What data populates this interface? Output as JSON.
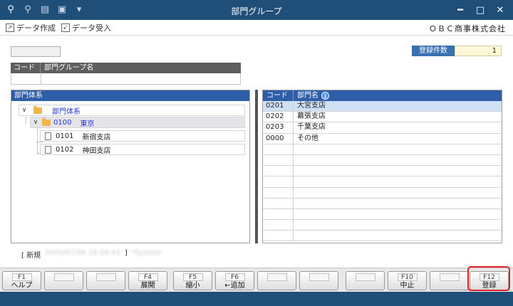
{
  "window": {
    "title": "部門グループ",
    "toolbar_icons": [
      "search-plus-icon",
      "search-icon",
      "printer-icon",
      "export-icon",
      "dropdown-icon"
    ],
    "controls": {
      "minimize": "━",
      "maximize": "□",
      "close": "✕"
    }
  },
  "toolbar": {
    "create_data": "データ作成",
    "receive_data": "データ受入",
    "company": "ＯＢＣ商事株式会社"
  },
  "record_count": {
    "label": "登録件数",
    "value": "1"
  },
  "group_table": {
    "headers": [
      "コード",
      "部門グループ名"
    ]
  },
  "tree": {
    "header": "部門体系",
    "root": "部門体系",
    "branch": {
      "code": "0100",
      "name": "東京"
    },
    "leaves": [
      {
        "code": "0101",
        "name": "新宿支店"
      },
      {
        "code": "0102",
        "name": "神田支店"
      }
    ]
  },
  "dept_list": {
    "headers": [
      "コード",
      "部門名"
    ],
    "rows": [
      {
        "code": "0201",
        "name": "大宮支店"
      },
      {
        "code": "0202",
        "name": "幕張支店"
      },
      {
        "code": "0203",
        "name": "千葉支店"
      },
      {
        "code": "0000",
        "name": "その他"
      }
    ]
  },
  "status": {
    "mode": "[ 新規",
    "timestamp": "2020/07/06 16:56:43",
    "close_bracket": "]",
    "user": "*System"
  },
  "fkeys": [
    {
      "num": "F1",
      "label": "ヘルプ"
    },
    {
      "num": "",
      "label": ""
    },
    {
      "num": "",
      "label": ""
    },
    {
      "num": "F4",
      "label": "展開"
    },
    {
      "num": "F5",
      "label": "縮小"
    },
    {
      "num": "F6",
      "label": "←追加"
    },
    {
      "num": "",
      "label": ""
    },
    {
      "num": "",
      "label": ""
    },
    {
      "num": "",
      "label": ""
    },
    {
      "num": "F10",
      "label": "中止"
    },
    {
      "num": "",
      "label": ""
    },
    {
      "num": "F12",
      "label": "登録"
    }
  ],
  "colors": {
    "titlebar": "#1f4e79",
    "panel_header": "#2f5ea8",
    "highlight": "#e0202a",
    "selected_row": "#cfe0f5"
  }
}
